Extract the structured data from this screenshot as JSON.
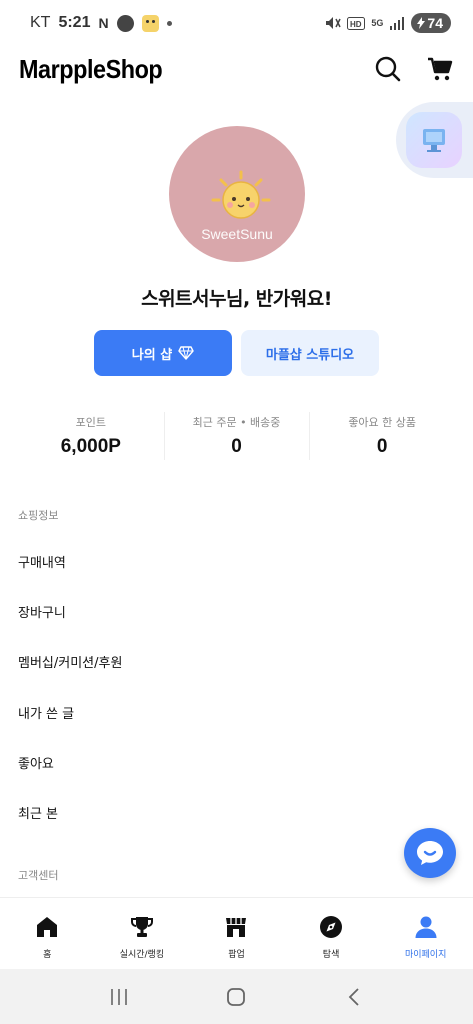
{
  "status_bar": {
    "carrier": "KT",
    "time": "5:21",
    "notification_n": "N",
    "network": "5G",
    "battery": "74"
  },
  "header": {
    "logo": "MarppleShop"
  },
  "profile": {
    "avatar_text": "SweetSunu",
    "greeting": "스위트서누님, 반가워요!"
  },
  "buttons": {
    "my_shop": "나의 샵",
    "studio": "마플샵 스튜디오"
  },
  "stats": [
    {
      "label": "포인트",
      "value": "6,000P"
    },
    {
      "label": "최근 주문 • 배송중",
      "value": "0"
    },
    {
      "label": "좋아요 한 상품",
      "value": "0"
    }
  ],
  "sections": {
    "shopping_info": "쇼핑정보",
    "customer_center": "고객센터"
  },
  "menu": [
    "구매내역",
    "장바구니",
    "멤버십/커미션/후원",
    "내가 쓴 글",
    "좋아요",
    "최근 본"
  ],
  "bottom_nav": [
    {
      "label": "홈",
      "icon": "home-icon"
    },
    {
      "label": "실시간/랭킹",
      "icon": "trophy-icon"
    },
    {
      "label": "팝업",
      "icon": "store-icon"
    },
    {
      "label": "탐색",
      "icon": "compass-icon"
    },
    {
      "label": "마이페이지",
      "icon": "person-icon",
      "active": true
    }
  ],
  "colors": {
    "accent": "#3b7bf5",
    "accent_light": "#eaf2fe",
    "avatar_bg": "#d9a7ab"
  }
}
